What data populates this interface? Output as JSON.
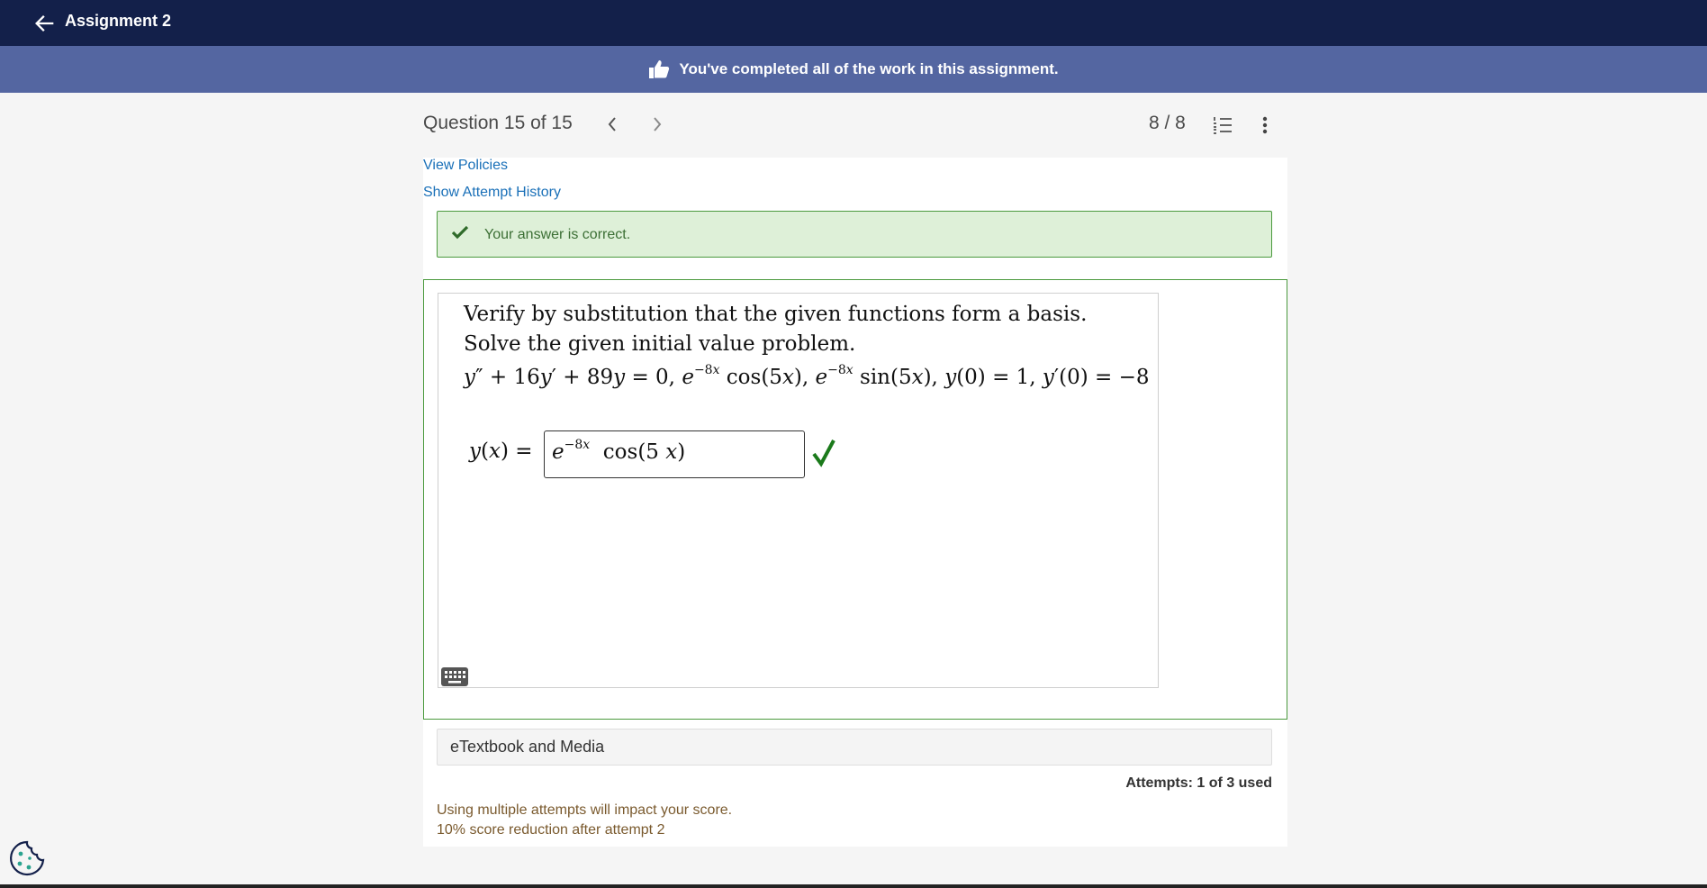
{
  "topbar": {
    "title": "Assignment 2",
    "back_icon": "arrow-left-icon"
  },
  "banner": {
    "icon": "thumbs-up-icon",
    "text": "You've completed all of the work in this assignment."
  },
  "question_header": {
    "question_label": "Question 15 of 15",
    "score": "8 / 8",
    "prev_icon": "chevron-left-icon",
    "next_icon": "chevron-right-icon",
    "list_icon": "numbered-list-icon",
    "more_icon": "more-vertical-icon"
  },
  "links": {
    "view_policies": "View Policies",
    "show_attempt_history": "Show Attempt History"
  },
  "alert": {
    "text": "Your answer is correct.",
    "icon": "checkmark-icon",
    "color": "#3c6f35"
  },
  "problem": {
    "line1": "Verify by substitution that the given functions form a basis.",
    "line2": "Solve the given initial value problem."
  },
  "answer": {
    "color": "#1b7a1b"
  },
  "etextbook": {
    "label": "eTextbook and Media"
  },
  "attempts": {
    "text": "Attempts: 1 of 3 used"
  },
  "notes": {
    "line1": "Using multiple attempts will impact your score.",
    "line2": "10% score reduction after attempt 2"
  },
  "colors": {
    "topbar": "#13204a",
    "banner": "#5466a1",
    "link": "#1a70b8",
    "success_border": "#4b9a3e"
  }
}
